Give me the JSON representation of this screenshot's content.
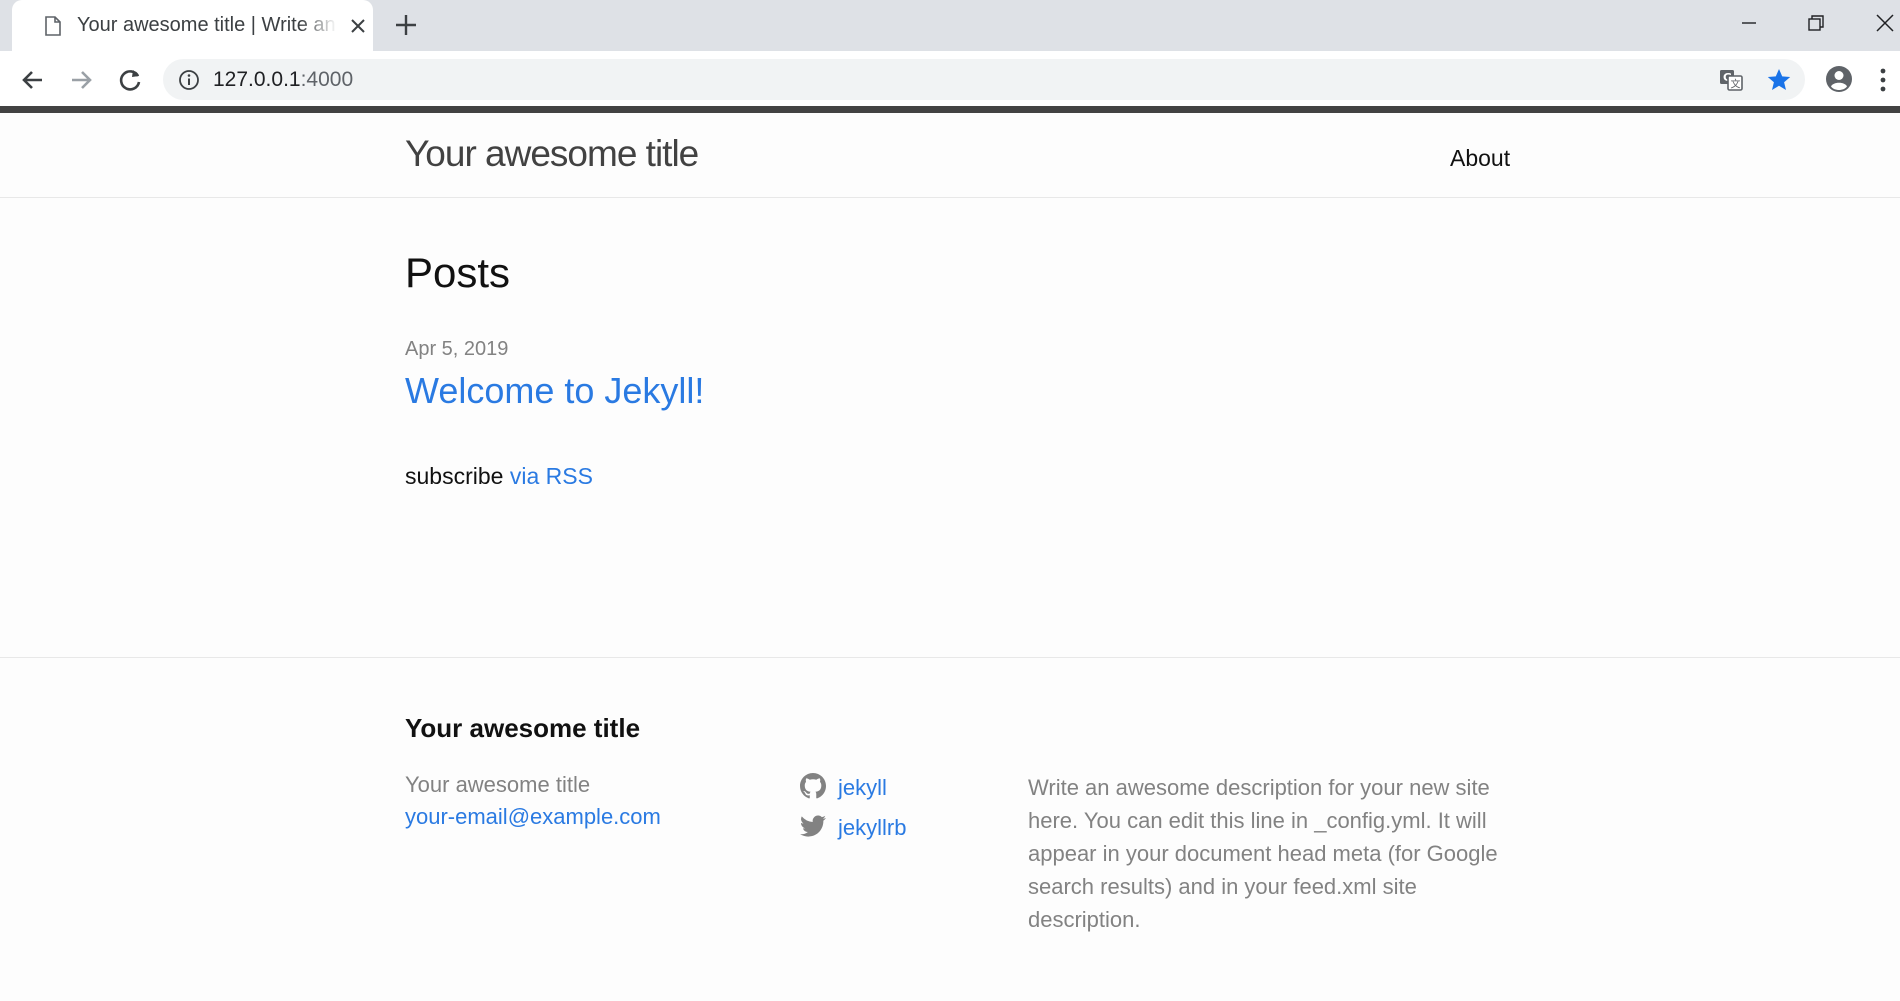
{
  "browser": {
    "tab_title": "Your awesome title | Write an awesome description for your new site",
    "url_host": "127.0.0.1",
    "url_port": ":4000",
    "icons": [
      "document-icon",
      "tab-close-icon",
      "new-tab-icon",
      "minimize-icon",
      "restore-icon",
      "window-close-icon",
      "back-icon",
      "forward-icon",
      "reload-icon",
      "info-icon",
      "translate-icon",
      "star-icon",
      "account-icon",
      "menu-icon"
    ],
    "accent_color": "#1a73e8"
  },
  "header": {
    "site_title": "Your awesome title",
    "nav": [
      {
        "label": "About"
      }
    ]
  },
  "main": {
    "heading": "Posts",
    "posts": [
      {
        "date": "Apr 5, 2019",
        "title": "Welcome to Jekyll!"
      }
    ],
    "subscribe_text": "subscribe",
    "rss_link_text": "via RSS"
  },
  "footer": {
    "heading": "Your awesome title",
    "name": "Your awesome title",
    "email": "your-email@example.com",
    "social": [
      {
        "icon": "github-icon",
        "label": "jekyll"
      },
      {
        "icon": "twitter-icon",
        "label": "jekyllrb"
      }
    ],
    "description": "Write an awesome description for your new site here. You can edit this line in _config.yml. It will appear in your document head meta (for Google search results) and in your feed.xml site description."
  },
  "colors": {
    "link": "#2a7ae2",
    "text": "#111111",
    "muted": "#828282",
    "header_stripe": "#424242"
  }
}
